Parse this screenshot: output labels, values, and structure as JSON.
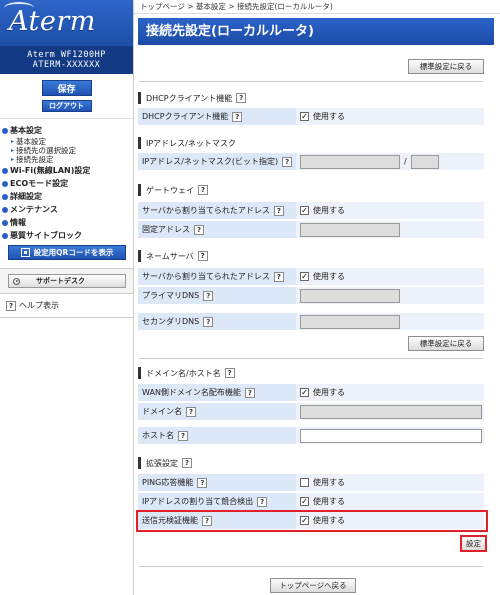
{
  "sidebar": {
    "brand": "Aterm",
    "model_line1": "Aterm WF1200HP",
    "model_line2": "ATERM-XXXXXX",
    "save_label": "保存",
    "logout_label": "ログアウト",
    "nav": [
      {
        "label": "基本設定",
        "subs": [
          "基本設定",
          "接続先の選択設定",
          "接続先設定"
        ]
      },
      {
        "label": "Wi-Fi(無線LAN)設定"
      },
      {
        "label": "ECOモード設定"
      },
      {
        "label": "詳細設定"
      },
      {
        "label": "メンテナンス"
      },
      {
        "label": "情報"
      },
      {
        "label": "悪質サイトブロック"
      }
    ],
    "qr_label": "設定用QRコードを表示",
    "support_label": "サポートデスク",
    "help_label": "ヘルプ表示"
  },
  "main": {
    "breadcrumb": "トップページ > 基本設定 > 接続先設定(ローカルルータ)",
    "title": "接続先設定(ローカルルータ)",
    "defaults_label": "標準設定に戻る",
    "use_label": "使用する",
    "help_glyph": "?",
    "sections": {
      "dhcp": {
        "title": "DHCPクライアント機能",
        "rows": [
          {
            "label": "DHCPクライアント機能",
            "checked": true
          }
        ]
      },
      "ip": {
        "title": "IPアドレス/ネットマスク",
        "rows": [
          {
            "label": "IPアドレス/ネットマスク(ビット指定)",
            "separator": "/"
          }
        ]
      },
      "gateway": {
        "title": "ゲートウェイ",
        "rows": [
          {
            "label": "サーバから割り当てられたアドレス",
            "checked": true
          },
          {
            "label": "固定アドレス"
          }
        ]
      },
      "dns": {
        "title": "ネームサーバ",
        "rows": [
          {
            "label": "サーバから割り当てられたアドレス",
            "checked": true
          },
          {
            "label": "プライマリDNS"
          },
          {
            "label": "セカンダリDNS"
          }
        ]
      },
      "domain": {
        "title": "ドメイン名/ホスト名",
        "rows": [
          {
            "label": "WAN側ドメイン名配布機能",
            "checked": true
          },
          {
            "label": "ドメイン名"
          },
          {
            "label": "ホスト名"
          }
        ]
      },
      "extended": {
        "title": "拡張設定",
        "rows": [
          {
            "label": "PING応答機能",
            "checked": false
          },
          {
            "label": "IPアドレスの割り当て競合検出",
            "checked": true
          },
          {
            "label": "送信元検証機能",
            "checked": true
          }
        ]
      }
    },
    "settings_label": "設定",
    "top_label": "トップページへ戻る"
  }
}
